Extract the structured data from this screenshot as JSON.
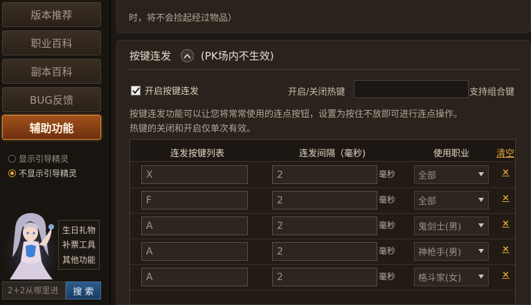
{
  "sidebar": {
    "nav": [
      "版本推荐",
      "职业百科",
      "副本百科",
      "BUG反馈",
      "辅助功能"
    ],
    "active_index": 4,
    "spirit_options": [
      "显示引导精灵",
      "不显示引导精灵"
    ],
    "spirit_selected": 1,
    "tools": [
      "生日礼物",
      "补票工具",
      "其他功能"
    ],
    "search": {
      "placeholder": "2+2从哪里进",
      "button": "搜 索"
    }
  },
  "top_panel": {
    "note": "时，将不会捡起经过物品）"
  },
  "section": {
    "title": "按键连发",
    "subtitle": "(PK场内不生效)",
    "enable_label": "开启按键连发",
    "enable_checked": true,
    "hotkey_label": "开启/关闭热键",
    "hotkey_value": "",
    "combo_label": "支持组合键",
    "desc_1": "按键连发功能可以让您将常常使用的连点按钮，设置为按住不放即可进行连点操作。",
    "desc_2": "热键的关闭和开启仅单次有效。"
  },
  "table": {
    "headers": {
      "key": "连发按键列表",
      "interval": "连发间隔（毫秒)",
      "job": "使用职业",
      "clear": "清空"
    },
    "unit": "毫秒",
    "delete_label": "×",
    "rows": [
      {
        "key": "X",
        "interval": "2",
        "job": "全部"
      },
      {
        "key": "F",
        "interval": "2",
        "job": "全部"
      },
      {
        "key": "A",
        "interval": "2",
        "job": "鬼剑士(男)"
      },
      {
        "key": "A",
        "interval": "2",
        "job": "神枪手(男)"
      },
      {
        "key": "A",
        "interval": "2",
        "job": "格斗家(女)"
      }
    ]
  },
  "colors": {
    "accent": "#e1a535",
    "active_nav": "#a2521a",
    "search_button": "#2c5d8c"
  }
}
